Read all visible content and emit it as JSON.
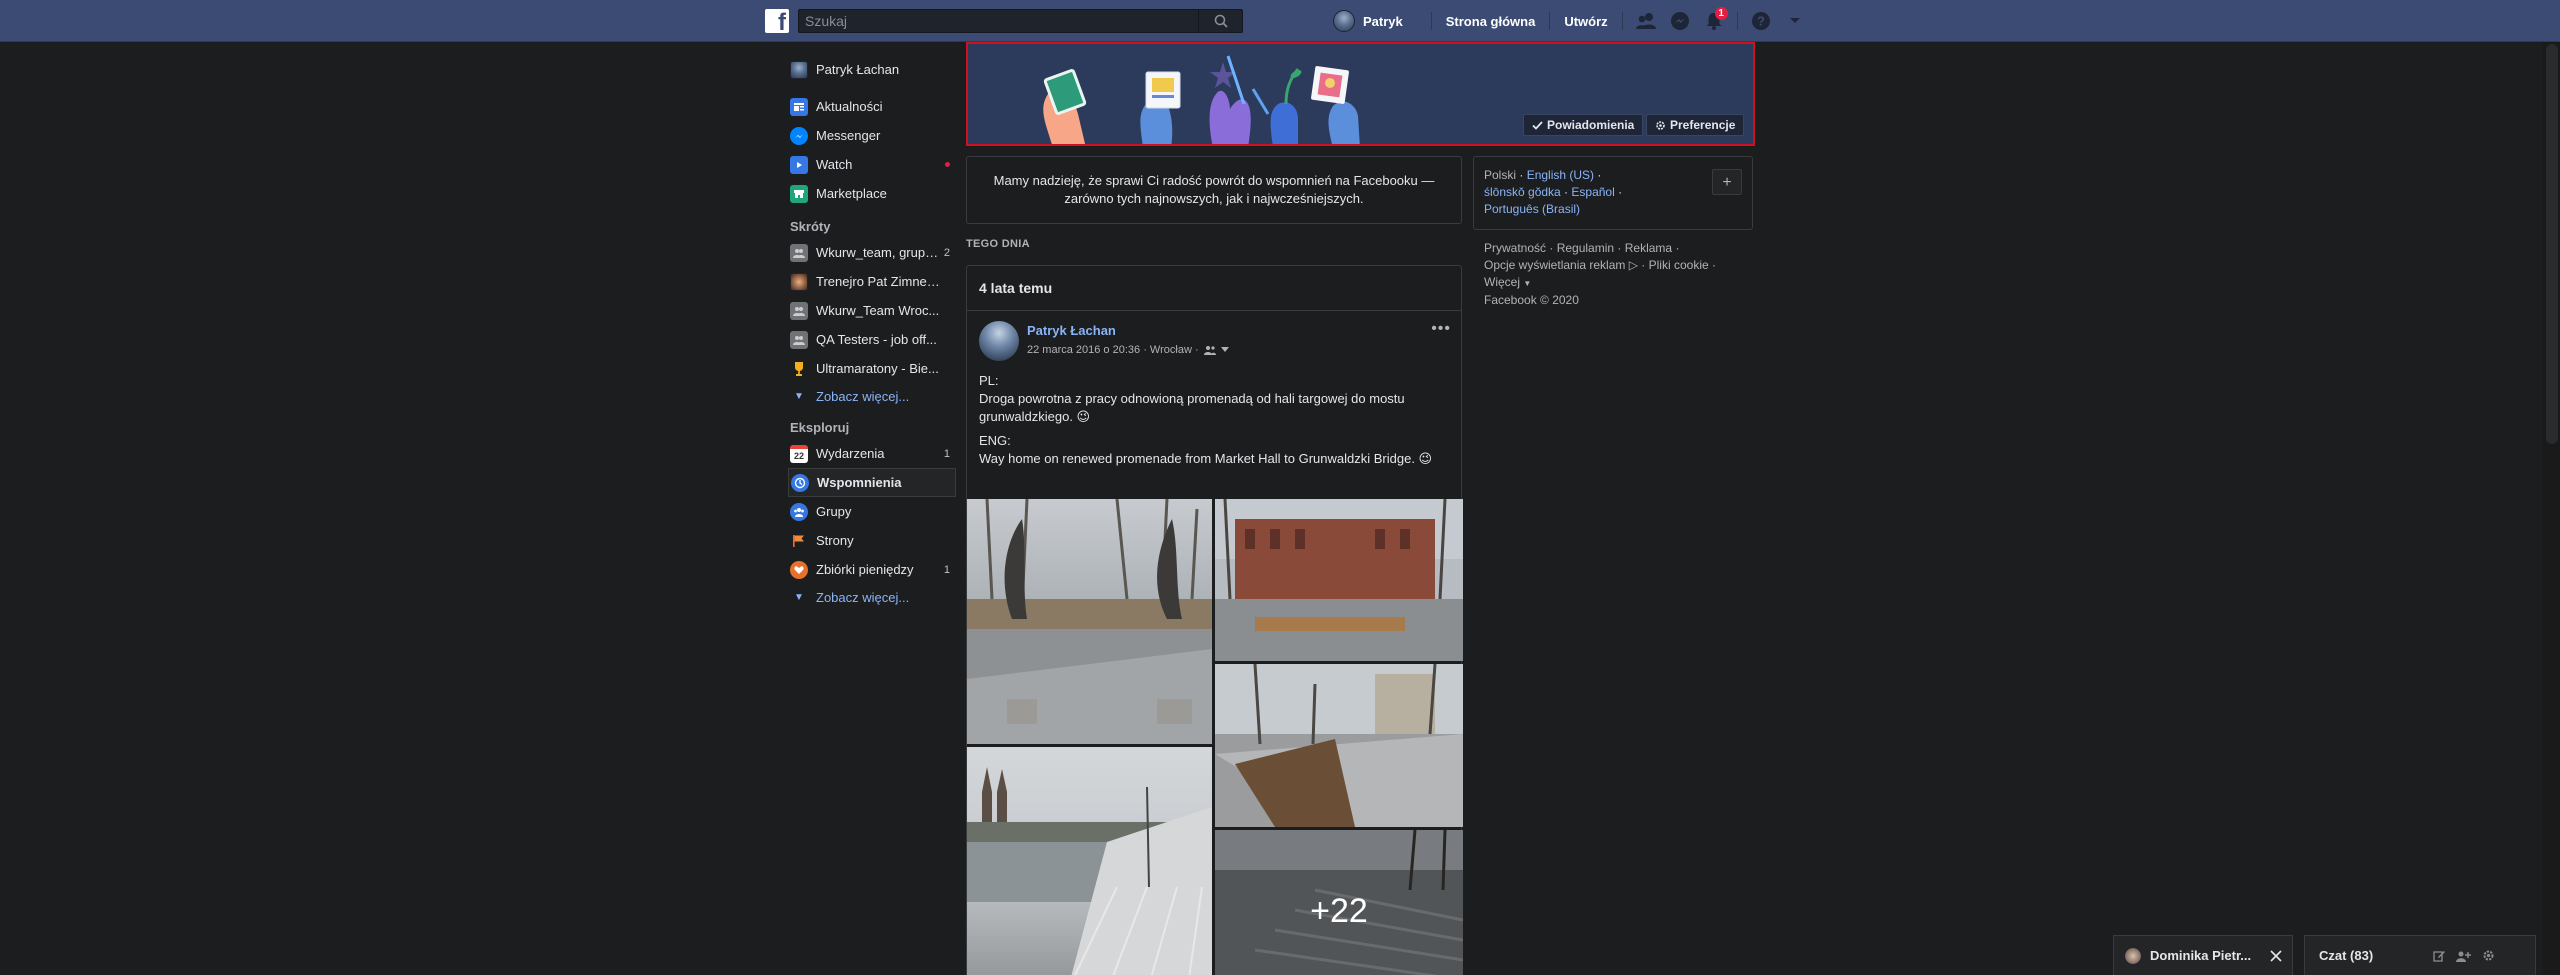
{
  "header": {
    "search_placeholder": "Szukaj",
    "profile_name": "Patryk",
    "home_label": "Strona główna",
    "create_label": "Utwórz",
    "notifications_count": "1"
  },
  "sidebar": {
    "user_name": "Patryk Łachan",
    "main_items": [
      {
        "label": "Aktualności"
      },
      {
        "label": "Messenger"
      },
      {
        "label": "Watch"
      },
      {
        "label": "Marketplace"
      }
    ],
    "shortcuts_heading": "Skróty",
    "shortcuts": [
      {
        "label": "Wkurw_team, grupa...",
        "count": "2"
      },
      {
        "label": "Trenejro Pat Zimnex..."
      },
      {
        "label": "Wkurw_Team Wroc..."
      },
      {
        "label": "QA Testers - job off..."
      },
      {
        "label": "Ultramaratony - Bie..."
      }
    ],
    "shortcuts_more": "Zobacz więcej...",
    "explore_heading": "Eksploruj",
    "explore": [
      {
        "label": "Wydarzenia",
        "count": "1"
      },
      {
        "label": "Wspomnienia"
      },
      {
        "label": "Grupy"
      },
      {
        "label": "Strony"
      },
      {
        "label": "Zbiórki pieniędzy",
        "count": "1"
      }
    ],
    "explore_more": "Zobacz więcej...",
    "events_icon_num": "22"
  },
  "banner": {
    "notifications_label": "Powiadomienia",
    "preferences_label": "Preferencje"
  },
  "hope_text": "Mamy nadzieję, że sprawi Ci radość powrót do wspomnień na Facebooku — zarówno tych najnowszych, jak i najwcześniejszych.",
  "section_label": "TEGO DNIA",
  "post": {
    "header": "4 lata temu",
    "author": "Patryk Łachan",
    "meta": "22 marca 2016 o 20:36 · Wrocław ·",
    "lines": [
      "PL:",
      "Droga powrotna z pracy odnowioną promenadą od hali targowej do mostu grunwaldzkiego. 😉",
      "ENG:",
      "Way home on renewed promenade from Market Hall to Grunwaldzki Bridge. 😉"
    ],
    "more_photos": "+22"
  },
  "languages": {
    "current": "Polski",
    "links": [
      "English (US)",
      "ślōnskŏ gŏdka",
      "Español",
      "Português (Brasil)"
    ]
  },
  "footer": {
    "links": [
      "Prywatność",
      "Regulamin",
      "Reklama",
      "Opcje wyświetlania reklam",
      "Pliki cookie",
      "Więcej"
    ],
    "copyright": "Facebook © 2020"
  },
  "chat": {
    "contact_name": "Dominika Pietr...",
    "chat_label": "Czat (83)"
  },
  "colors": {
    "topbar": "#3b4b73",
    "background": "#1c1d1f",
    "link": "#8ab4f8",
    "banner_border": "#d0111d"
  }
}
